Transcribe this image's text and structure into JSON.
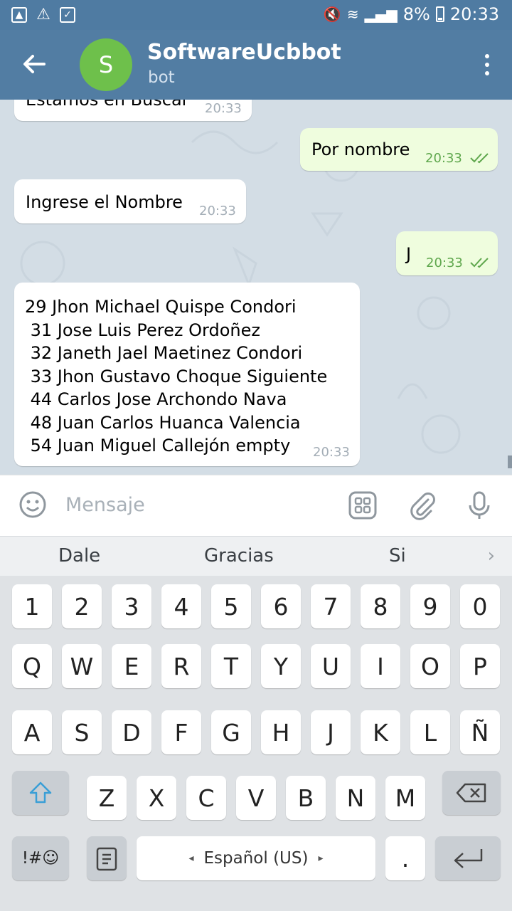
{
  "status_bar": {
    "battery": "8%",
    "time": "20:33"
  },
  "header": {
    "avatar_letter": "S",
    "title": "SoftwareUcbbot",
    "subtitle": "bot"
  },
  "messages": [
    {
      "side": "in",
      "text": "Estamos en Buscar",
      "time": "20:33"
    },
    {
      "side": "out",
      "text": "Por nombre",
      "time": "20:33"
    },
    {
      "side": "in",
      "text": "Ingrese el Nombre",
      "time": "20:33"
    },
    {
      "side": "out",
      "text": "J",
      "time": "20:33"
    },
    {
      "side": "in",
      "text": "29 Jhon Michael Quispe Condori\n 31 Jose Luis Perez Ordoñez\n 32 Janeth Jael Maetinez Condori\n 33 Jhon Gustavo Choque Siguiente\n 44 Carlos Jose Archondo Nava\n 48 Juan Carlos Huanca Valencia\n 54 Juan Miguel Callejón empty",
      "time": "20:33"
    }
  ],
  "composer": {
    "placeholder": "Mensaje"
  },
  "suggestions": [
    "Dale",
    "Gracias",
    "Si"
  ],
  "keyboard": {
    "row_numbers": [
      "1",
      "2",
      "3",
      "4",
      "5",
      "6",
      "7",
      "8",
      "9",
      "0"
    ],
    "row_1": [
      "Q",
      "W",
      "E",
      "R",
      "T",
      "Y",
      "U",
      "I",
      "O",
      "P"
    ],
    "row_2": [
      "A",
      "S",
      "D",
      "F",
      "G",
      "H",
      "J",
      "K",
      "L",
      "Ñ"
    ],
    "row_3": [
      "Z",
      "X",
      "C",
      "V",
      "B",
      "N",
      "M"
    ],
    "symbols_label": "!#☺",
    "space_label": "Español (US)",
    "period_label": "."
  },
  "colors": {
    "header": "#527da3",
    "avatar": "#6ec04b",
    "outgoing_bubble": "#effdde",
    "chat_background": "#d3dde5"
  }
}
